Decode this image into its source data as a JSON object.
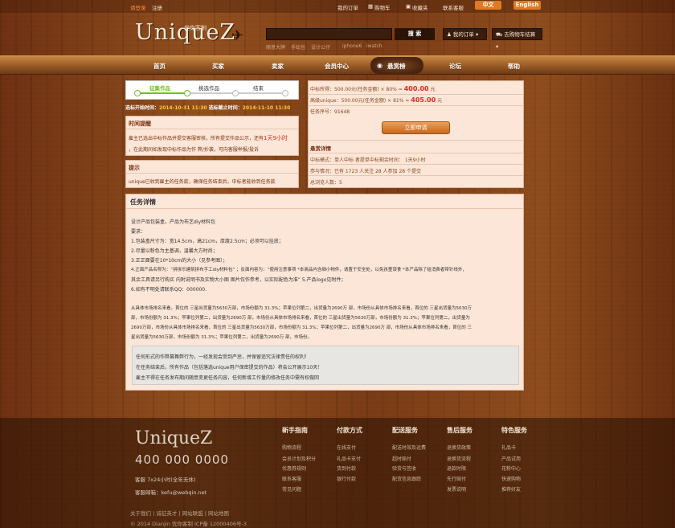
{
  "topbar": {
    "login": "请登录",
    "register": "注册",
    "my_orders": "我的订单",
    "cart": "购物车",
    "favorites": "收藏夹",
    "contact": "联系客服",
    "lang_zh": "中文",
    "lang_en": "English"
  },
  "header": {
    "logo": "UniqueZ",
    "slogan": "优你客制",
    "search_value": "",
    "search_button": "搜 索",
    "hot_words": [
      "随意大牌",
      "手绘包",
      "设计公仔",
      "iphone6",
      "iwatch"
    ],
    "my_orders_btn": "我的订单",
    "cart_btn": "去购物车结算"
  },
  "nav": {
    "items": [
      "首页",
      "买家",
      "卖家",
      "会员中心",
      "悬赏榜",
      "论坛",
      "帮助"
    ],
    "active": "悬赏榜"
  },
  "steps": {
    "step1": "征集作品",
    "step2": "挑选作品",
    "step3": "结束"
  },
  "timeline": {
    "start_label": "选标开始时间：",
    "start_value": "2014-10-31 11:30",
    "end_label": "选标截止时间：",
    "end_value": "2014-11-10 11:30"
  },
  "reminder": {
    "title": "时间提醒",
    "line1_prefix": "雇主已选出中标作品并提交客服审核，所有提交作品公示，还有",
    "line1_highlight": "1天9小时",
    "line2": "，在此期间如发现中标作品为作 弊/抄袭，可向客服举报/投诉"
  },
  "tip": {
    "title": "提示",
    "text": "unique已收到雇主的任务款，确保任务结束后，中标者能收到任务款"
  },
  "reward": {
    "line1_prefix": "中标所得：500.00元(任务金额) × 80% =",
    "line1_value": "400.00",
    "line1_unit": "元",
    "line2_prefix": "高级unique：500.00元(任务金额) × 81% =",
    "line2_value": "405.00",
    "line2_unit": "元",
    "task_no": "任务序号：91648",
    "apply_button": "立即申请",
    "info_title": "悬赏详情",
    "mode": "中标模式：单人中标  者提单中标剩余时间：  1天9小时",
    "participation": "参与情况：已有 1723 人关注 28 人参加 28 个提交",
    "views": "总浏览人数：5"
  },
  "detail": {
    "title": "任务详情",
    "lines": [
      "设计产品包装盒，产品为布艺diy材料包",
      "要求：",
      "1.包装盒尺寸为：宽14.5cm，高21cm，厚度2.5cm；必须可以挂放；",
      "2.尽量以粉色为主基调，温馨大方时尚；",
      "3.正正面要在10*10cm的大小（见参考图）；",
      "4.正面产品名称为：“拼拼乐建筑拼布手工diy材料包” ；反面内容为：“使用注意事项 *本商品内含细小物件，请置于安全处，以免孩童误食 *本产品除了给消费者带针线外，",
      "其余工具请另行购买 内附说明书及实物大小图 图片仅作参考，以实际配色为准”  5.产品logo见附件；",
      "6.如有不明处请联系QQ：000000."
    ],
    "para": [
      "从具体市场排名来看，首位的 三星出货量为5630万部，市场份额为 31.3%；苹果位列第二，出货量为2690万 部，市场份从具体市场排名来看，首位的 三星出货量为5630万",
      "部，市场份额为 31.3%；苹果位列第二，出货量为2690万 部，市场份从具体市场排名来看，首位的 三星出货量为5630万部，市场份额为 31.3%；苹果位列第二，出货量为",
      "2690万部，市场份从具体市场排名来看，首位的 三星出货量为5630万部，市场份额为 31.3%；苹果位列第二，出货量为2690万 部，市场份从具体市场排名来看，首位的 三",
      "星出货量为5630万部，市场份额为 31.3%；苹果位列第二，出货量为2690万 部，市场份。"
    ],
    "notice": [
      "任何形式的作弊篡舞弊行为，一经发现会受到严惩，并保留追究法律责任的权利！",
      "在任务结束后，所有作品（包括落选unique用户保密提交的作品）将会公开展示10天！",
      "雇主不得在任务发布期间随意变更任务内容，任何新增工作量的修改任务中需有权做回"
    ]
  },
  "footer": {
    "logo": "UniqueZ",
    "phone": "400 000 0000",
    "service_hours": "客服 7x24小时(全年无休)",
    "email": "客服邮箱：kefu@webqin.net",
    "columns": [
      {
        "title": "新手指南",
        "links": [
          "购物流程",
          "会员计划及积分",
          "优惠券规则",
          "联系客服",
          "常见问题"
        ]
      },
      {
        "title": "付款方式",
        "links": [
          "在线支付",
          "礼品卡支付",
          "货到付款",
          "银行付款"
        ]
      },
      {
        "title": "配送服务",
        "links": [
          "配送时效及运费",
          "超时赔付",
          "验货与签收",
          "配货信息跟踪"
        ]
      },
      {
        "title": "售后服务",
        "links": [
          "退换货政策",
          "退换货流程",
          "退款时限",
          "先行赔付",
          "发票说明"
        ]
      },
      {
        "title": "特色服务",
        "links": [
          "礼品卡",
          "产品试用",
          "花粉中心",
          "快速购物",
          "推荐好友"
        ]
      }
    ],
    "bottom_links": "关于我们 | 诚征英才 | 网站联盟 | 网站地图",
    "copyright": "© 2014 Dianjin 优你客制 ICP备 12000406号-3"
  },
  "colors": {
    "accent_red": "#e8261c",
    "nav_orange": "#b06a2c",
    "panel_bg": "#fbe6d8",
    "step_green": "#6fbf1f"
  }
}
